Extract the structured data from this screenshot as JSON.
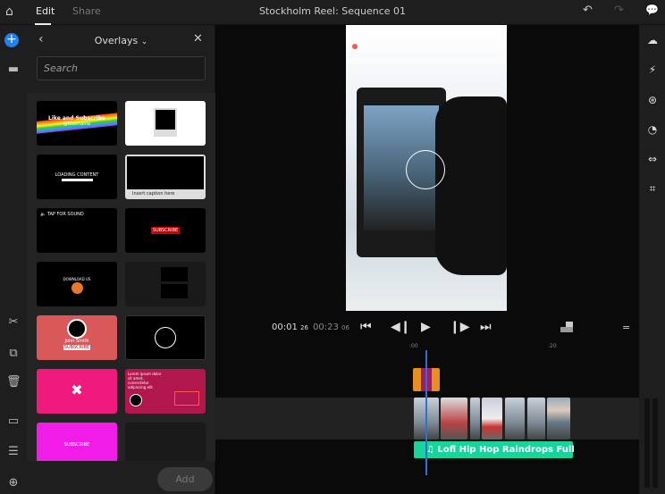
{
  "topbar": {
    "tabs": [
      {
        "label": "Edit",
        "active": true
      },
      {
        "label": "Share",
        "active": false
      }
    ],
    "title": "Stockholm Reel: Sequence 01"
  },
  "panel": {
    "title": "Overlays",
    "search_placeholder": "Search",
    "add_label": "Add",
    "thumbs": [
      {
        "label": "Like and Subscribe",
        "sub": "@Username"
      },
      {
        "label": ""
      },
      {
        "label": "LOADING CONTENT"
      },
      {
        "label": "Insert caption here"
      },
      {
        "label": "TAP FOR SOUND"
      },
      {
        "label": "SUBSCRIBE"
      },
      {
        "label": "DOWNLOAD US"
      },
      {
        "label": ""
      },
      {
        "label": "John Smith",
        "sub": "SUBSCRIBE"
      },
      {
        "label": ""
      },
      {
        "label": ""
      },
      {
        "label": "Lorem ipsum dolor sit amet, consectetur adipiscing elit."
      },
      {
        "label": "SUBSCRIBE"
      },
      {
        "label": ""
      }
    ]
  },
  "player": {
    "current_time": "00:01",
    "current_frames": "26",
    "total_time": "00:23",
    "total_frames": "06"
  },
  "timeline": {
    "ruler": [
      ":00",
      ":20"
    ],
    "audio_clip": "Lofi Hip Hop Raindrops Full"
  },
  "colors": {
    "accent": "#2f6fd6",
    "overlay_clip": "#e8901e",
    "audio_clip": "#18d39a",
    "add_button": "#2680eb"
  }
}
